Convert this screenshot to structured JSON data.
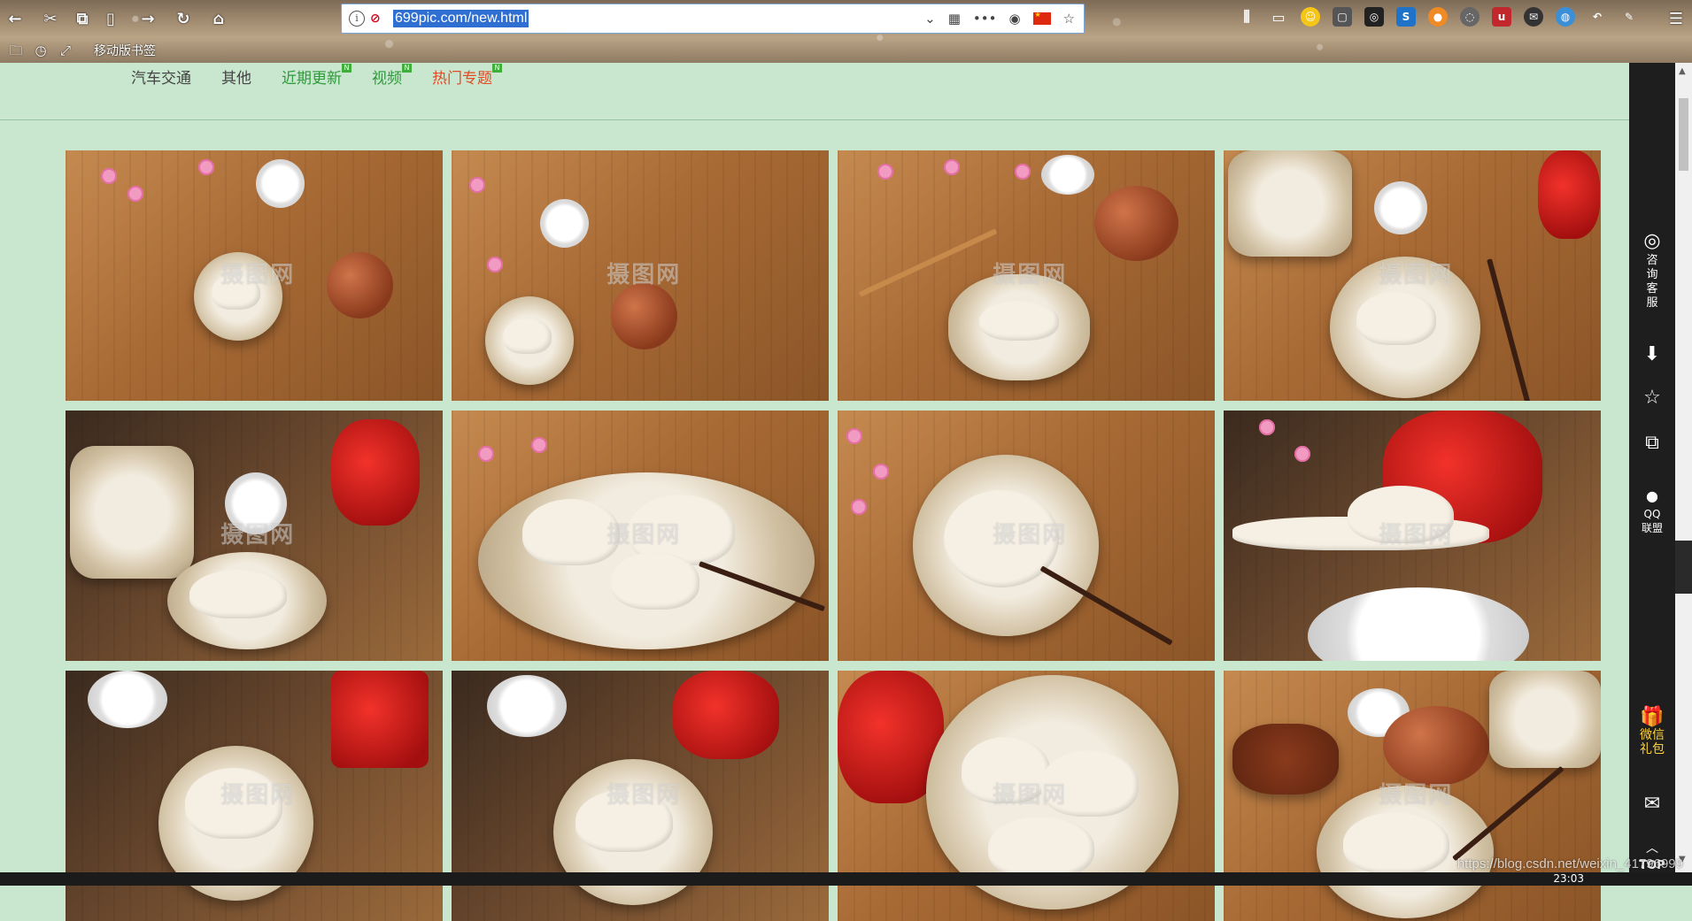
{
  "browser": {
    "url": "699pic.com/new.html",
    "bookmarks_label": "移动版书签"
  },
  "nav": {
    "items": [
      {
        "label": "汽车交通",
        "style": "normal"
      },
      {
        "label": "其他",
        "style": "normal"
      },
      {
        "label": "近期更新",
        "style": "green",
        "badge": "N"
      },
      {
        "label": "视频",
        "style": "green",
        "badge": "N"
      },
      {
        "label": "热门专题",
        "style": "red",
        "badge": "N"
      }
    ]
  },
  "gallery": {
    "watermark": "摄图网",
    "subjects": [
      "dumplings-bowl-teapot",
      "dumplings-bowl-teapot",
      "dumplings-bowl-spoon",
      "dumplings-plate-steamer",
      "dumplings-steamer-plate",
      "dumplings-plate-closeup",
      "dumplings-plate-chopsticks",
      "dumpling-on-spoon",
      "dumplings-bowl-tray",
      "dumplings-bowl-tray",
      "dumplings-plate-red-bag",
      "dumplings-plate-teapot"
    ]
  },
  "sidebar": {
    "consult_label": "咨询客服",
    "qq_label": "QQ联盟",
    "gift_label": "微信礼包",
    "top_label": "TOP"
  },
  "overlay": {
    "source_url": "https://blog.csdn.net/weixin_41796999",
    "clock": "23:03"
  },
  "colors": {
    "page_bg": "#c9e7cf",
    "nav_green": "#2e9a3b",
    "nav_red": "#e34a26",
    "sidebar_bg": "#1e1e1e"
  }
}
